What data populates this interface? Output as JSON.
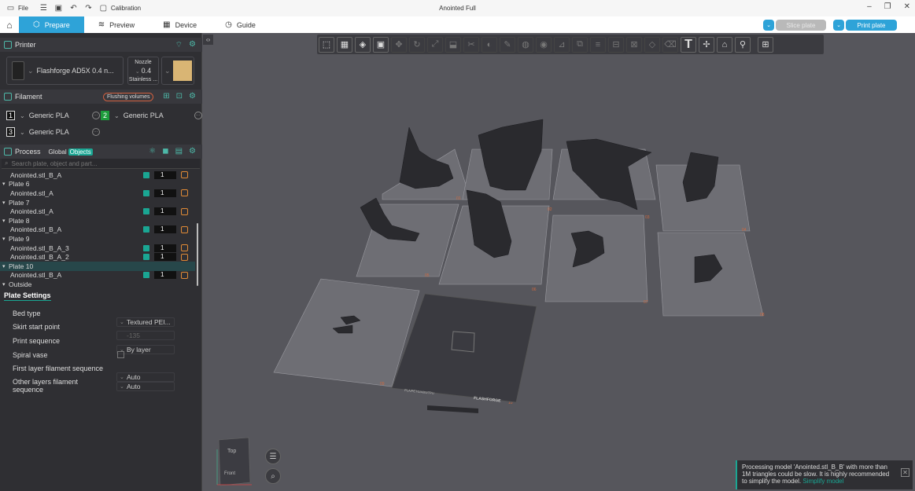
{
  "titlebar": {
    "file_label": "File",
    "calibration_label": "Calibration",
    "title": "Anointed Full"
  },
  "tabs": [
    {
      "label": "Prepare",
      "icon": "prepare-icon"
    },
    {
      "label": "Preview",
      "icon": "preview-icon"
    },
    {
      "label": "Device",
      "icon": "device-icon"
    },
    {
      "label": "Guide",
      "icon": "guide-icon"
    }
  ],
  "actions": {
    "slice_label": "Slice plate",
    "print_label": "Print plate"
  },
  "printer": {
    "section": "Printer",
    "name": "Flashforge AD5X 0.4 n...",
    "nozzle_label": "Nozzle",
    "nozzle_value": "0.4",
    "nozzle_type": "Stainless ...",
    "plate_color": "#d9b574"
  },
  "filament": {
    "section": "Filament",
    "flushing_label": "Flushing volumes",
    "slots": [
      {
        "num": "1",
        "name": "Generic PLA"
      },
      {
        "num": "2",
        "name": "Generic PLA"
      },
      {
        "num": "3",
        "name": "Generic PLA"
      }
    ]
  },
  "process": {
    "section": "Process",
    "global_label": "Global",
    "objects_label": "Objects",
    "search_placeholder": "Search plate, object and part..."
  },
  "tree": [
    {
      "label": "Anointed.stl_B_A",
      "count": "1",
      "indent": "child"
    },
    {
      "label": "Plate 6",
      "indent": "plate"
    },
    {
      "label": "Anointed.stl_A",
      "count": "1",
      "indent": "child"
    },
    {
      "label": "Plate 7",
      "indent": "plate"
    },
    {
      "label": "Anointed.stl_A",
      "count": "1",
      "indent": "child"
    },
    {
      "label": "Plate 8",
      "indent": "plate"
    },
    {
      "label": "Anointed.stl_B_A",
      "count": "1",
      "indent": "child"
    },
    {
      "label": "Plate 9",
      "indent": "plate"
    },
    {
      "label": "Anointed.stl_B_A_3",
      "count": "1",
      "indent": "child"
    },
    {
      "label": "Anointed.stl_B_A_2",
      "count": "1",
      "indent": "child"
    },
    {
      "label": "Plate 10",
      "indent": "plate"
    },
    {
      "label": "Anointed.stl_B_A",
      "count": "1",
      "indent": "child"
    },
    {
      "label": "Outside",
      "indent": "plate"
    }
  ],
  "plate_settings": {
    "title": "Plate Settings",
    "rows": [
      {
        "label": "Bed type",
        "value": "Textured PEI..."
      },
      {
        "label": "Skirt start point",
        "value": "-135"
      },
      {
        "label": "Print sequence",
        "value": "By layer"
      },
      {
        "label": "Spiral vase",
        "value": ""
      },
      {
        "label": "First layer filament sequence",
        "value": "Auto"
      },
      {
        "label": "Other layers filament sequence",
        "value": "Auto"
      }
    ]
  },
  "viewport": {
    "cube_top": "Top",
    "cube_front": "Front",
    "plate_labels": [
      "01",
      "02",
      "03",
      "04",
      "05",
      "06",
      "07",
      "08",
      "09",
      "10"
    ],
    "bed_brand": "FLASHFORGE",
    "bed_material": "PLA/PETG/ABS/TPU"
  },
  "notification": {
    "text": "Processing model 'Anointed.stl_B_B' with more than 1M triangles could be slow. It is highly recommended to simplify the model.",
    "link": "Simplify model"
  }
}
